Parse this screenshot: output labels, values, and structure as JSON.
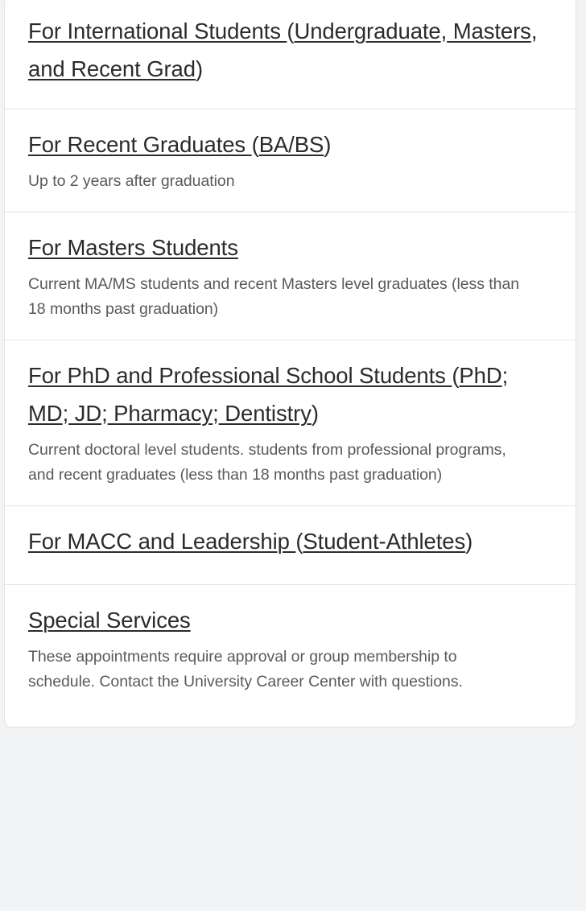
{
  "theme": {
    "page_background": "#f1f3f4",
    "card_background": "#ffffff",
    "border_color": "#e3e3e3",
    "title_color": "#2b2b2b",
    "description_color": "#5a5a5a"
  },
  "sections": [
    {
      "id": "international",
      "title": "For International Students (Undergraduate, Masters, and Recent Grad)",
      "title_parts": [
        {
          "text": "For International Students ",
          "underline": true
        },
        {
          "text": "(",
          "underline": false
        },
        {
          "text": "Undergraduate",
          "underline": true
        },
        {
          "text": ",",
          "underline": false
        },
        {
          "text": " Masters",
          "underline": true
        },
        {
          "text": ",",
          "underline": false
        },
        {
          "text": " and Recent Grad",
          "underline": true
        },
        {
          "text": ")",
          "underline": false
        }
      ],
      "description": ""
    },
    {
      "id": "recent",
      "title": "For Recent Graduates (BA/BS)",
      "title_parts": [
        {
          "text": "For Recent Graduates ",
          "underline": true
        },
        {
          "text": "(",
          "underline": false
        },
        {
          "text": "BA/BS",
          "underline": true
        },
        {
          "text": ")",
          "underline": false
        }
      ],
      "description": "Up to 2 years after graduation"
    },
    {
      "id": "masters",
      "title": "For Masters Students",
      "title_parts": [
        {
          "text": "For Masters Students",
          "underline": true
        }
      ],
      "description": "Current MA/MS students and recent Masters level graduates (less than 18 months past graduation)"
    },
    {
      "id": "phd",
      "title": "For PhD and Professional School Students (PhD; MD; JD; Pharmacy; Dentistry)",
      "title_parts": [
        {
          "text": "For PhD and Professional School Students ",
          "underline": true
        },
        {
          "text": "(",
          "underline": false
        },
        {
          "text": "PhD",
          "underline": true
        },
        {
          "text": ";",
          "underline": false
        },
        {
          "text": " MD",
          "underline": true
        },
        {
          "text": ";",
          "underline": false
        },
        {
          "text": " JD",
          "underline": true
        },
        {
          "text": ";",
          "underline": false
        },
        {
          "text": " Pharmacy",
          "underline": true
        },
        {
          "text": ";",
          "underline": false
        },
        {
          "text": " Dentistry",
          "underline": true
        },
        {
          "text": ")",
          "underline": false
        }
      ],
      "description": "Current doctoral level students. students from professional programs, and recent graduates (less than 18 months past graduation)"
    },
    {
      "id": "macc",
      "title": "For MACC and Leadership (Student-Athletes)",
      "title_parts": [
        {
          "text": "For MACC and Leadership ",
          "underline": true
        },
        {
          "text": "(",
          "underline": false
        },
        {
          "text": "Student-Athletes",
          "underline": true
        },
        {
          "text": ")",
          "underline": false
        }
      ],
      "description": ""
    },
    {
      "id": "special",
      "title": "Special Services",
      "title_parts": [
        {
          "text": "Special Services",
          "underline": true
        }
      ],
      "description": "These appointments require approval or group membership to schedule. Contact the University Career Center with questions."
    }
  ]
}
